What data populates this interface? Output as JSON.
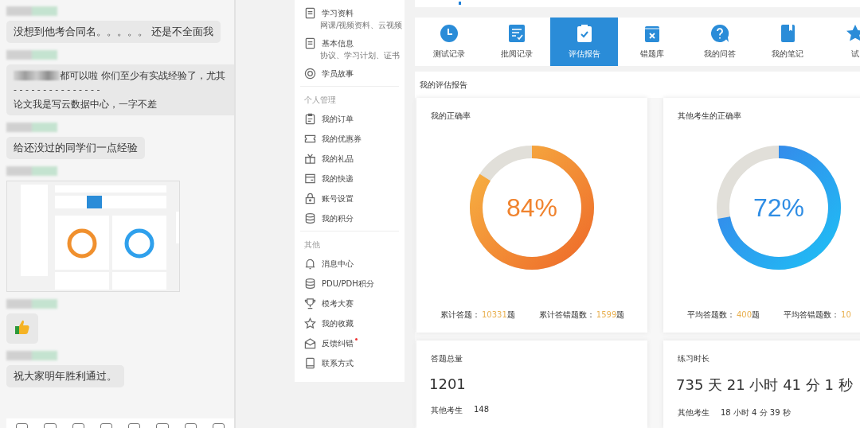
{
  "chat": {
    "messages": [
      {
        "kind": "text",
        "text": "没想到他考合同名。。。。。 还是不全面我"
      },
      {
        "kind": "quote",
        "quote_tail": "都可以啦 你们至少有实战经验了，尤其",
        "divider": "- - - - - - - - - - - - - - -",
        "text": "论文我是写云数据中心，一字不差"
      },
      {
        "kind": "text",
        "text": "给还没过的同学们一点经验"
      },
      {
        "kind": "picture"
      },
      {
        "kind": "emoji"
      },
      {
        "kind": "text",
        "text": "祝大家明年胜利通过。"
      }
    ]
  },
  "sidebar": {
    "groups": [
      {
        "items": [
          {
            "label": "学习资料",
            "sub": "网课/视频资料、云视频"
          },
          {
            "label": "基本信息",
            "sub": "协议、学习计划、证书"
          },
          {
            "label": "学员故事"
          }
        ]
      },
      {
        "title": "个人管理",
        "items": [
          {
            "label": "我的订单"
          },
          {
            "label": "我的优惠券"
          },
          {
            "label": "我的礼品"
          },
          {
            "label": "我的快递"
          },
          {
            "label": "账号设置"
          },
          {
            "label": "我的积分"
          }
        ]
      },
      {
        "title": "其他",
        "items": [
          {
            "label": "消息中心"
          },
          {
            "label": "PDU/PDH积分"
          },
          {
            "label": "模考大赛"
          },
          {
            "label": "我的收藏"
          },
          {
            "label": "反馈纠错",
            "badge": true
          },
          {
            "label": "联系方式"
          }
        ]
      }
    ]
  },
  "tabs": [
    {
      "label": "测试记录",
      "selected": false
    },
    {
      "label": "批阅记录",
      "selected": false
    },
    {
      "label": "评估报告",
      "selected": true
    },
    {
      "label": "错题库",
      "selected": false
    },
    {
      "label": "我的问答",
      "selected": false
    },
    {
      "label": "我的笔记",
      "selected": false
    },
    {
      "label": "试",
      "selected": false
    }
  ],
  "report": {
    "title": "我的评估报告",
    "cards": [
      {
        "title": "我的正确率",
        "percent": "84%",
        "level": 0.84,
        "color": "#f0832e",
        "stats": [
          {
            "label": "累计答题：",
            "value": "10331",
            "unit": "题"
          },
          {
            "label": "累计答错题数：",
            "value": "1599",
            "unit": "题"
          }
        ]
      },
      {
        "title": "其他考生的正确率",
        "percent": "72%",
        "level": 0.72,
        "color": "#2f8de4",
        "stats": [
          {
            "label": "平均答题数：",
            "value": "400",
            "unit": "题"
          },
          {
            "label": "平均答错题数：",
            "value": "10"
          }
        ]
      }
    ],
    "totals": [
      {
        "title": "答题总量",
        "value": "1201",
        "other_label": "其他考生",
        "other_value": "148"
      },
      {
        "title": "练习时长",
        "value": "735 天 21 小时 41 分 1 秒",
        "other_label": "其他考生",
        "other_value": "18 小时 4 分 39 秒"
      }
    ]
  }
}
